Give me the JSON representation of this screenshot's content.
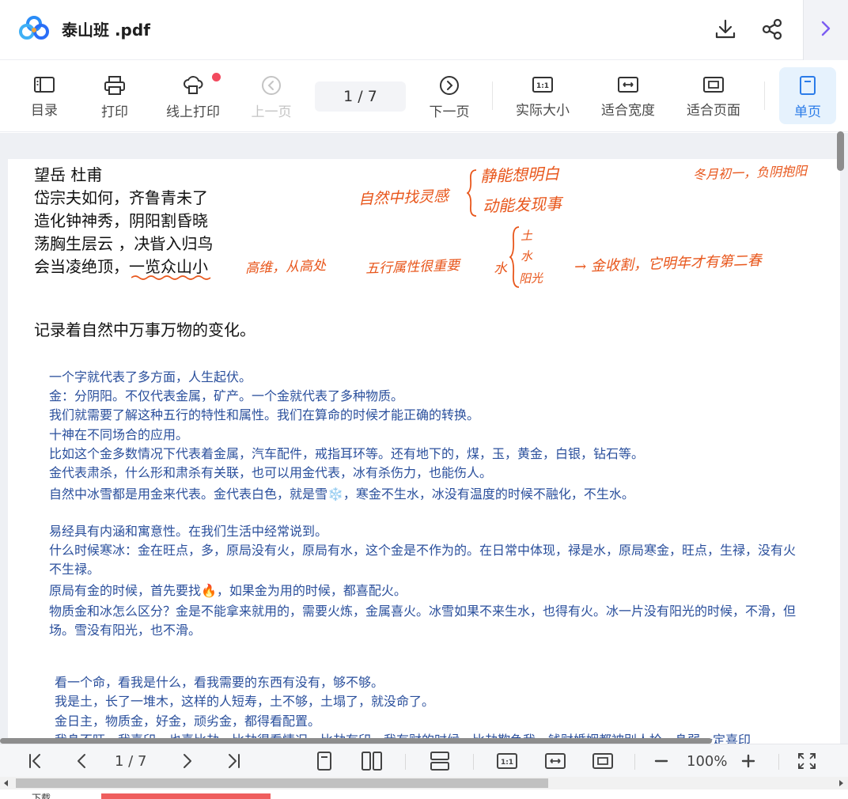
{
  "titlebar": {
    "title": "泰山班 .pdf",
    "icons": [
      "app-logo-icon",
      "download-icon",
      "share-icon",
      "chevron-right-icon"
    ]
  },
  "toolbar": {
    "toc": "目录",
    "print": "打印",
    "online_print": "线上打印",
    "prev": "上一页",
    "page_indicator": "1  / 7",
    "next": "下一页",
    "actual_size": "实际大小",
    "fit_width": "适合宽度",
    "fit_page": "适合页面",
    "single_page": "单页",
    "accent": "#2b7ce9"
  },
  "document": {
    "poem": [
      "望岳 杜甫",
      "岱宗夫如何，齐鲁青未了",
      "造化钟神秀，阴阳割昏晓",
      "荡胸生层云 ，决眥入归鸟",
      "会当凌绝顶，一览众山小"
    ],
    "lead": "记录着自然中万事万物的变化。",
    "para1": [
      "一个字就代表了多方面，人生起伏。",
      "金：分阴阳。不仅代表金属，矿产。一个金就代表了多种物质。",
      "我们就需要了解这种五行的特性和属性。我们在算命的时候才能正确的转换。",
      "十神在不同场合的应用。",
      "比如这个金多数情况下代表着金属，汽车配件，戒指耳环等。还有地下的，煤，玉，黄金，白银，钻石等。",
      "金代表肃杀，什么形和肃杀有关联，也可以用金代表，冰有杀伤力，也能伤人。",
      "自然中冰雪都是用金来代表。金代表白色，就是雪❄️，寒金不生水，冰没有温度的时候不融化，不生水。"
    ],
    "para2": [
      "易经具有内涵和寓意性。在我们生活中经常说到。",
      "什么时候寒冰：金在旺点，多，原局没有火，原局有水，这个金是不作为的。在日常中体现，禄是水，原局寒金，旺点，生禄，没有火",
      "不生禄。",
      "原局有金的时候，首先要找🔥，如果金为用的时候，都喜配火。",
      "物质金和冰怎么区分？金是不能拿来就用的，需要火炼，金属喜火。冰雪如果不来生水，也得有火。冰一片没有阳光的时候，不滑，但",
      "场。雪没有阳光，也不滑。"
    ],
    "para3": [
      "看一个命，看我是什么，看我需要的东西有没有，够不够。",
      "我是土，长了一堆木，这样的人短寿，土不够，土塌了，就没命了。",
      "金日主，物质金，好金，顽劣金，都得看配置。",
      "我身不旺，我喜印，也喜比劫，比劫得看情况，比劫有印，我有财的时候，比劫欺负我，钱财婚姻都被别人抢，身弱一定喜印"
    ],
    "handwriting": {
      "natural": "自然中找灵感",
      "still": "静能想明白",
      "move": "动能发现事",
      "winter": "冬月初一，负阴抱阳",
      "height": "高维，从高处",
      "wuxing": "五行属性很重要",
      "water": "水",
      "earth": "土",
      "water2": "水",
      "sun": "阳光",
      "gold": "→ 金收割，它明年才有第二春"
    },
    "hand_color": "#e8561b",
    "text_blue": "#2a4f9c"
  },
  "bottombar": {
    "page_indicator": "1 / 7",
    "zoom": "100%"
  },
  "strip": {
    "label": "下载"
  }
}
